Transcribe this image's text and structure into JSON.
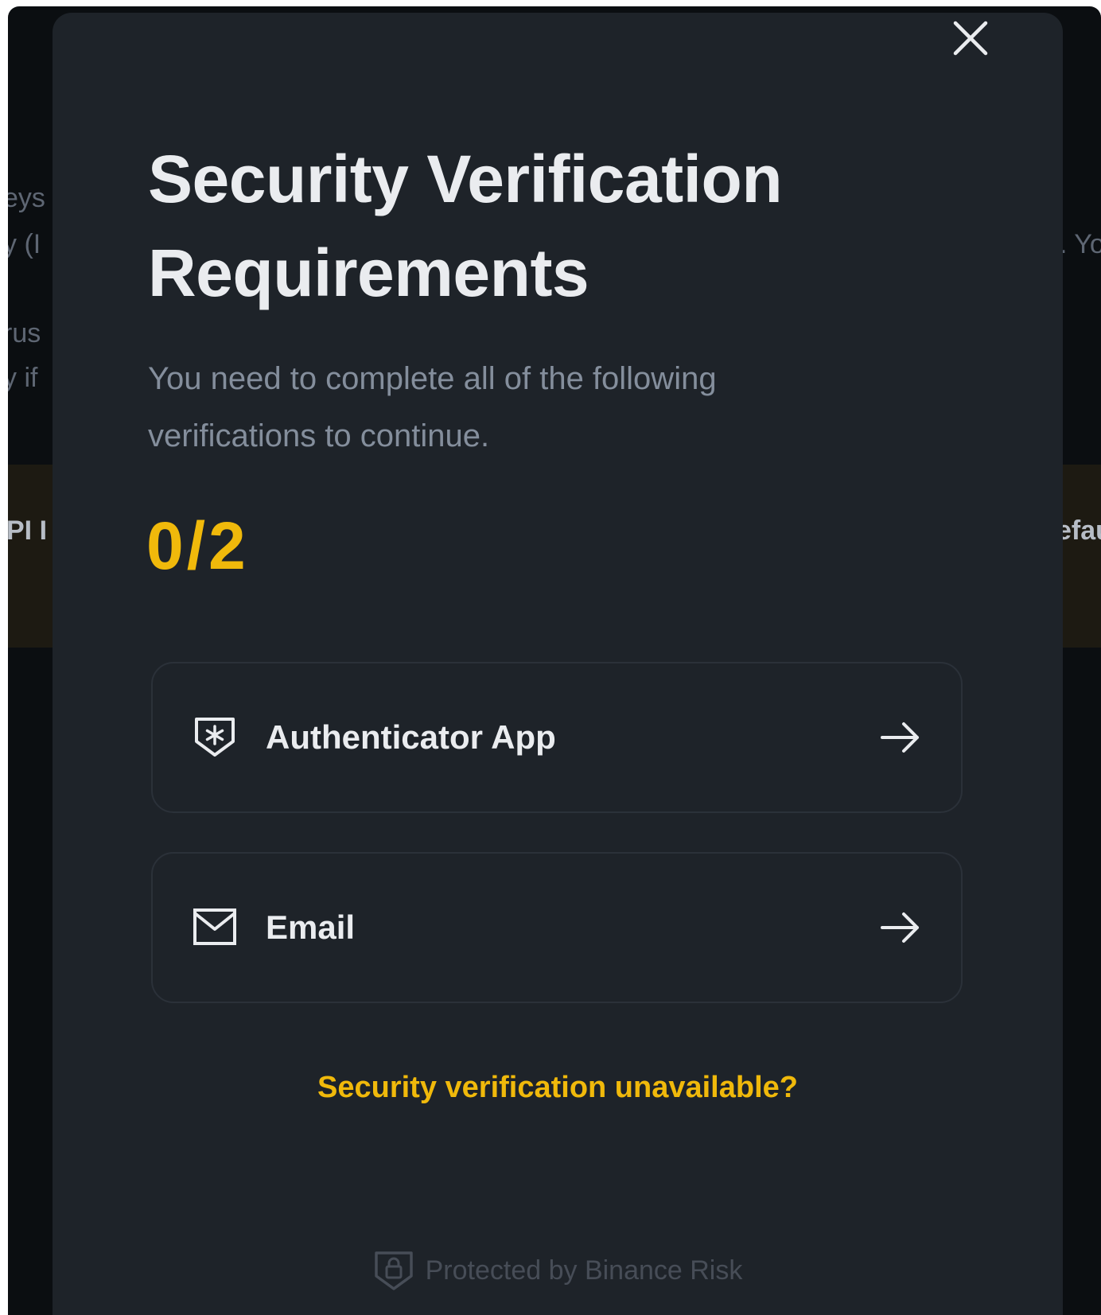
{
  "background": {
    "fragments": [
      "eys",
      "y (I",
      "rus",
      "y if",
      ". Yo"
    ],
    "banner_fragments": [
      "PI I",
      "efau"
    ]
  },
  "modal": {
    "title_line1": "Security Verification",
    "title_line2": "Requirements",
    "subtitle_line1": "You need to complete all of the following",
    "subtitle_line2": "verifications to continue.",
    "progress": "0/2",
    "options": [
      {
        "label": "Authenticator App",
        "icon": "authenticator-shield-icon"
      },
      {
        "label": "Email",
        "icon": "envelope-icon"
      }
    ],
    "unavailable_link": "Security verification unavailable?",
    "footer": "Protected by Binance Risk"
  },
  "colors": {
    "modal_bg": "#1e2329",
    "accent": "#f0b90b",
    "text_primary": "#eaecef",
    "text_secondary": "#848e9c",
    "border": "#2b3139"
  }
}
